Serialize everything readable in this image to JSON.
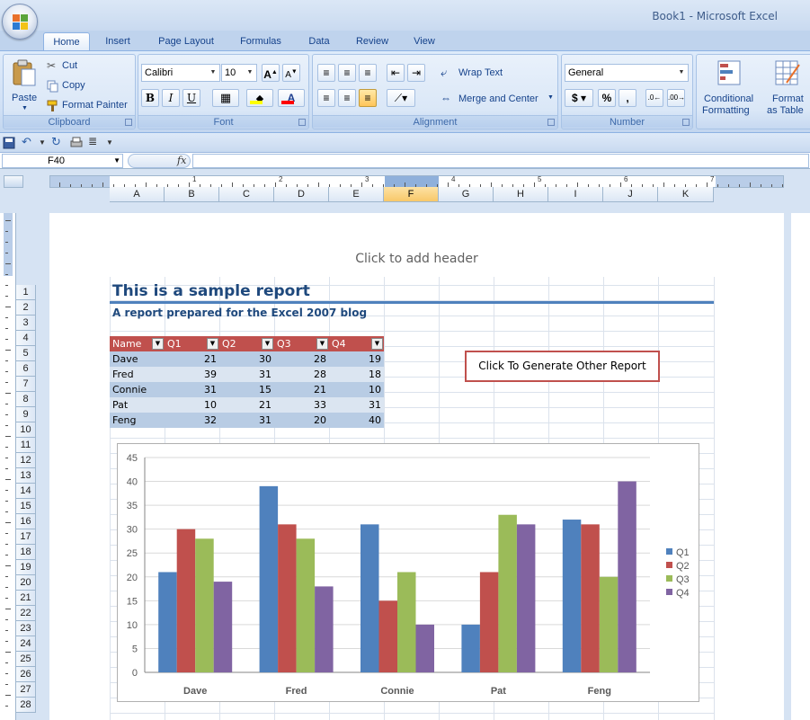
{
  "app": {
    "title": "Book1 - Microsoft Excel"
  },
  "tabs": [
    "Home",
    "Insert",
    "Page Layout",
    "Formulas",
    "Data",
    "Review",
    "View"
  ],
  "ribbon": {
    "clipboard": {
      "label": "Clipboard",
      "paste": "Paste",
      "cut": "Cut",
      "copy": "Copy",
      "format_painter": "Format Painter"
    },
    "font": {
      "label": "Font",
      "font_name": "Calibri",
      "font_size": "10"
    },
    "alignment": {
      "label": "Alignment",
      "wrap_text": "Wrap Text",
      "merge_center": "Merge and Center"
    },
    "number": {
      "label": "Number",
      "format": "General"
    },
    "styles": {
      "conditional_line1": "Conditional",
      "conditional_line2": "Formatting",
      "format_table_line1": "Format",
      "format_table_line2": "as Table"
    }
  },
  "formula_bar": {
    "cell_ref": "F40",
    "fx": "fx",
    "value": ""
  },
  "columns": [
    "A",
    "B",
    "C",
    "D",
    "E",
    "F",
    "G",
    "H",
    "I",
    "J",
    "K"
  ],
  "selected_column": "F",
  "ruler_numbers": [
    "1",
    "2",
    "3",
    "4",
    "5",
    "6",
    "7"
  ],
  "rows": [
    "1",
    "2",
    "3",
    "4",
    "5",
    "6",
    "7",
    "8",
    "9",
    "10",
    "11",
    "12",
    "13",
    "14",
    "15",
    "16",
    "17",
    "18",
    "19",
    "20",
    "21",
    "22",
    "23",
    "24",
    "25",
    "26",
    "27",
    "28"
  ],
  "page": {
    "header_placeholder": "Click to add header"
  },
  "report": {
    "title": "This is a sample report",
    "subtitle": "A report prepared for the Excel 2007 blog",
    "table": {
      "headers": [
        "Name",
        "Q1",
        "Q2",
        "Q3",
        "Q4"
      ],
      "rows": [
        [
          "Dave",
          "21",
          "30",
          "28",
          "19"
        ],
        [
          "Fred",
          "39",
          "31",
          "28",
          "18"
        ],
        [
          "Connie",
          "31",
          "15",
          "21",
          "10"
        ],
        [
          "Pat",
          "10",
          "21",
          "33",
          "31"
        ],
        [
          "Feng",
          "32",
          "31",
          "20",
          "40"
        ]
      ]
    }
  },
  "generate_button": "Click To Generate Other Report",
  "chart_data": {
    "type": "bar",
    "categories": [
      "Dave",
      "Fred",
      "Connie",
      "Pat",
      "Feng"
    ],
    "series": [
      {
        "name": "Q1",
        "color": "#4f81bd",
        "values": [
          21,
          39,
          31,
          10,
          32
        ]
      },
      {
        "name": "Q2",
        "color": "#c0504d",
        "values": [
          30,
          31,
          15,
          21,
          31
        ]
      },
      {
        "name": "Q3",
        "color": "#9bbb59",
        "values": [
          28,
          28,
          21,
          33,
          20
        ]
      },
      {
        "name": "Q4",
        "color": "#8064a2",
        "values": [
          19,
          18,
          10,
          31,
          40
        ]
      }
    ],
    "ylim": [
      0,
      45
    ],
    "yticks": [
      "0",
      "5",
      "10",
      "15",
      "20",
      "25",
      "30",
      "35",
      "40",
      "45"
    ],
    "grid": true,
    "legend": "right",
    "title": "",
    "xlabel": "",
    "ylabel": ""
  }
}
